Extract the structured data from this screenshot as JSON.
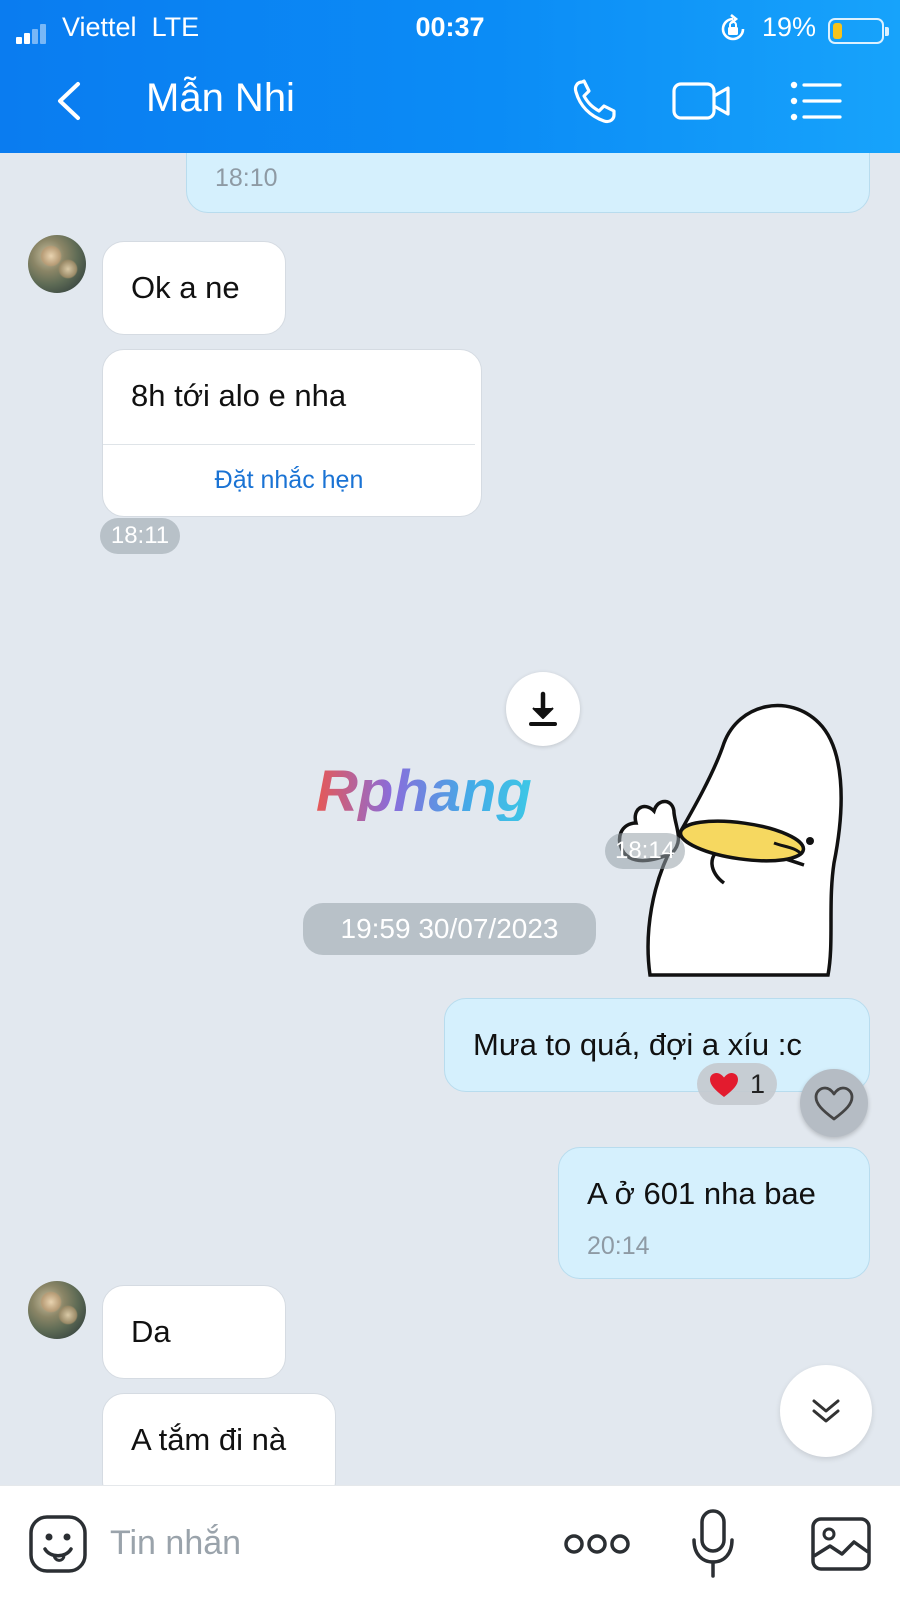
{
  "status_bar": {
    "carrier": "Viettel",
    "network": "LTE",
    "time": "00:37",
    "battery": "19%",
    "battery_level": 0.19
  },
  "header": {
    "contact_name": "Mẫn Nhi",
    "icons": [
      "back-icon",
      "phone-icon",
      "video-call-icon",
      "menu-list-icon"
    ]
  },
  "messages": {
    "prev_time": "18:10",
    "m1_text": "Ok a ne",
    "m2_text": "8h tới alo e nha",
    "m2_action": "Đặt nhắc hẹn",
    "m2_time": "18:11",
    "sticker_time": "18:14",
    "watermark": "Rphang",
    "date_separator": "19:59 30/07/2023",
    "m3_text": "Mưa to quá, đợi a xíu :c",
    "m3_reaction_count": "1",
    "m4_text": "A ở 601 nha bae",
    "m4_time": "20:14",
    "m5_text": "Da",
    "m6_text": "A tắm đi nà"
  },
  "composer": {
    "placeholder": "Tin nhắn"
  },
  "colors": {
    "header": "#0b8cf6",
    "outgoing": "#d5f0fd",
    "incoming": "#ffffff",
    "background": "#e2e8ef",
    "link": "#1a73d4"
  }
}
